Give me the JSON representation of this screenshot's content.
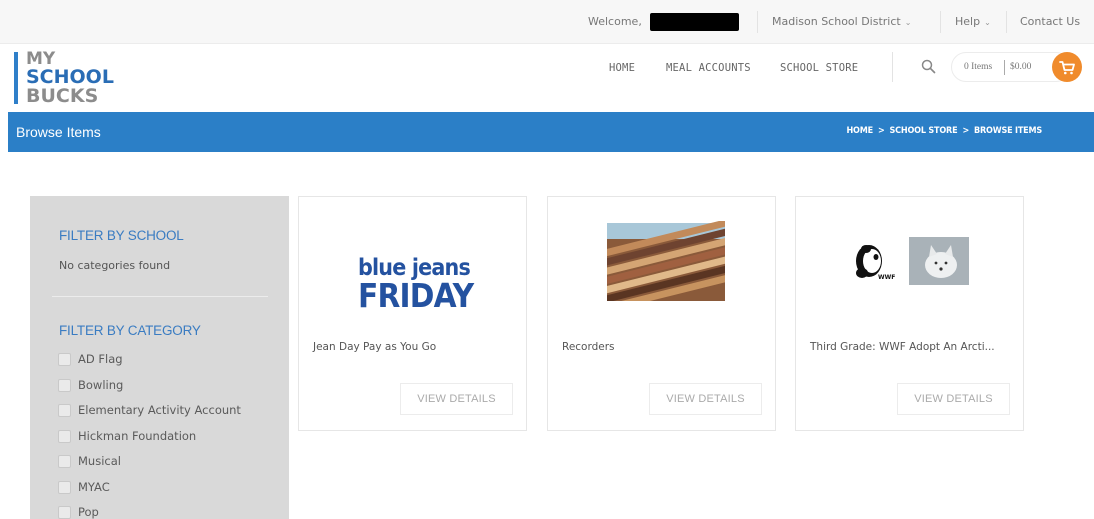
{
  "topbar": {
    "welcome": "Welcome,",
    "district": "Madison School District",
    "help": "Help",
    "contact": "Contact Us"
  },
  "logo": {
    "line1": "MY",
    "line2": "SCHOOL",
    "line3": "BUCKS"
  },
  "nav": {
    "home": "HOME",
    "meal_accounts": "MEAL ACCOUNTS",
    "school_store": "SCHOOL STORE"
  },
  "cart": {
    "items": "0 Items",
    "total": "$0.00"
  },
  "band": {
    "title": "Browse Items",
    "breadcrumb": [
      "HOME",
      "SCHOOL STORE",
      "BROWSE ITEMS"
    ],
    "separator": ">"
  },
  "sidebar": {
    "school_heading": "FILTER BY SCHOOL",
    "no_categories": "No categories found",
    "category_heading": "FILTER BY CATEGORY",
    "categories": [
      "AD Flag",
      "Bowling",
      "Elementary Activity Account",
      "Hickman Foundation",
      "Musical",
      "MYAC",
      "Pop"
    ]
  },
  "products": [
    {
      "title": "Jean Day Pay as You Go",
      "button": "VIEW DETAILS",
      "image_text_top": "blue jeans",
      "image_text_bottom": "FRIDAY"
    },
    {
      "title": "Recorders",
      "button": "VIEW DETAILS"
    },
    {
      "title": "Third Grade: WWF Adopt An Arcti...",
      "button": "VIEW DETAILS",
      "image_text": "WWF"
    }
  ],
  "colors": {
    "brand_blue": "#2b7fc7",
    "logo_blue": "#2a6db5",
    "cart_orange": "#f08b2c",
    "sidebar_grey": "#d9d9d9"
  },
  "icons": {
    "search": "search-icon",
    "cart": "cart-icon",
    "dropdown": "chevron-down-icon"
  }
}
